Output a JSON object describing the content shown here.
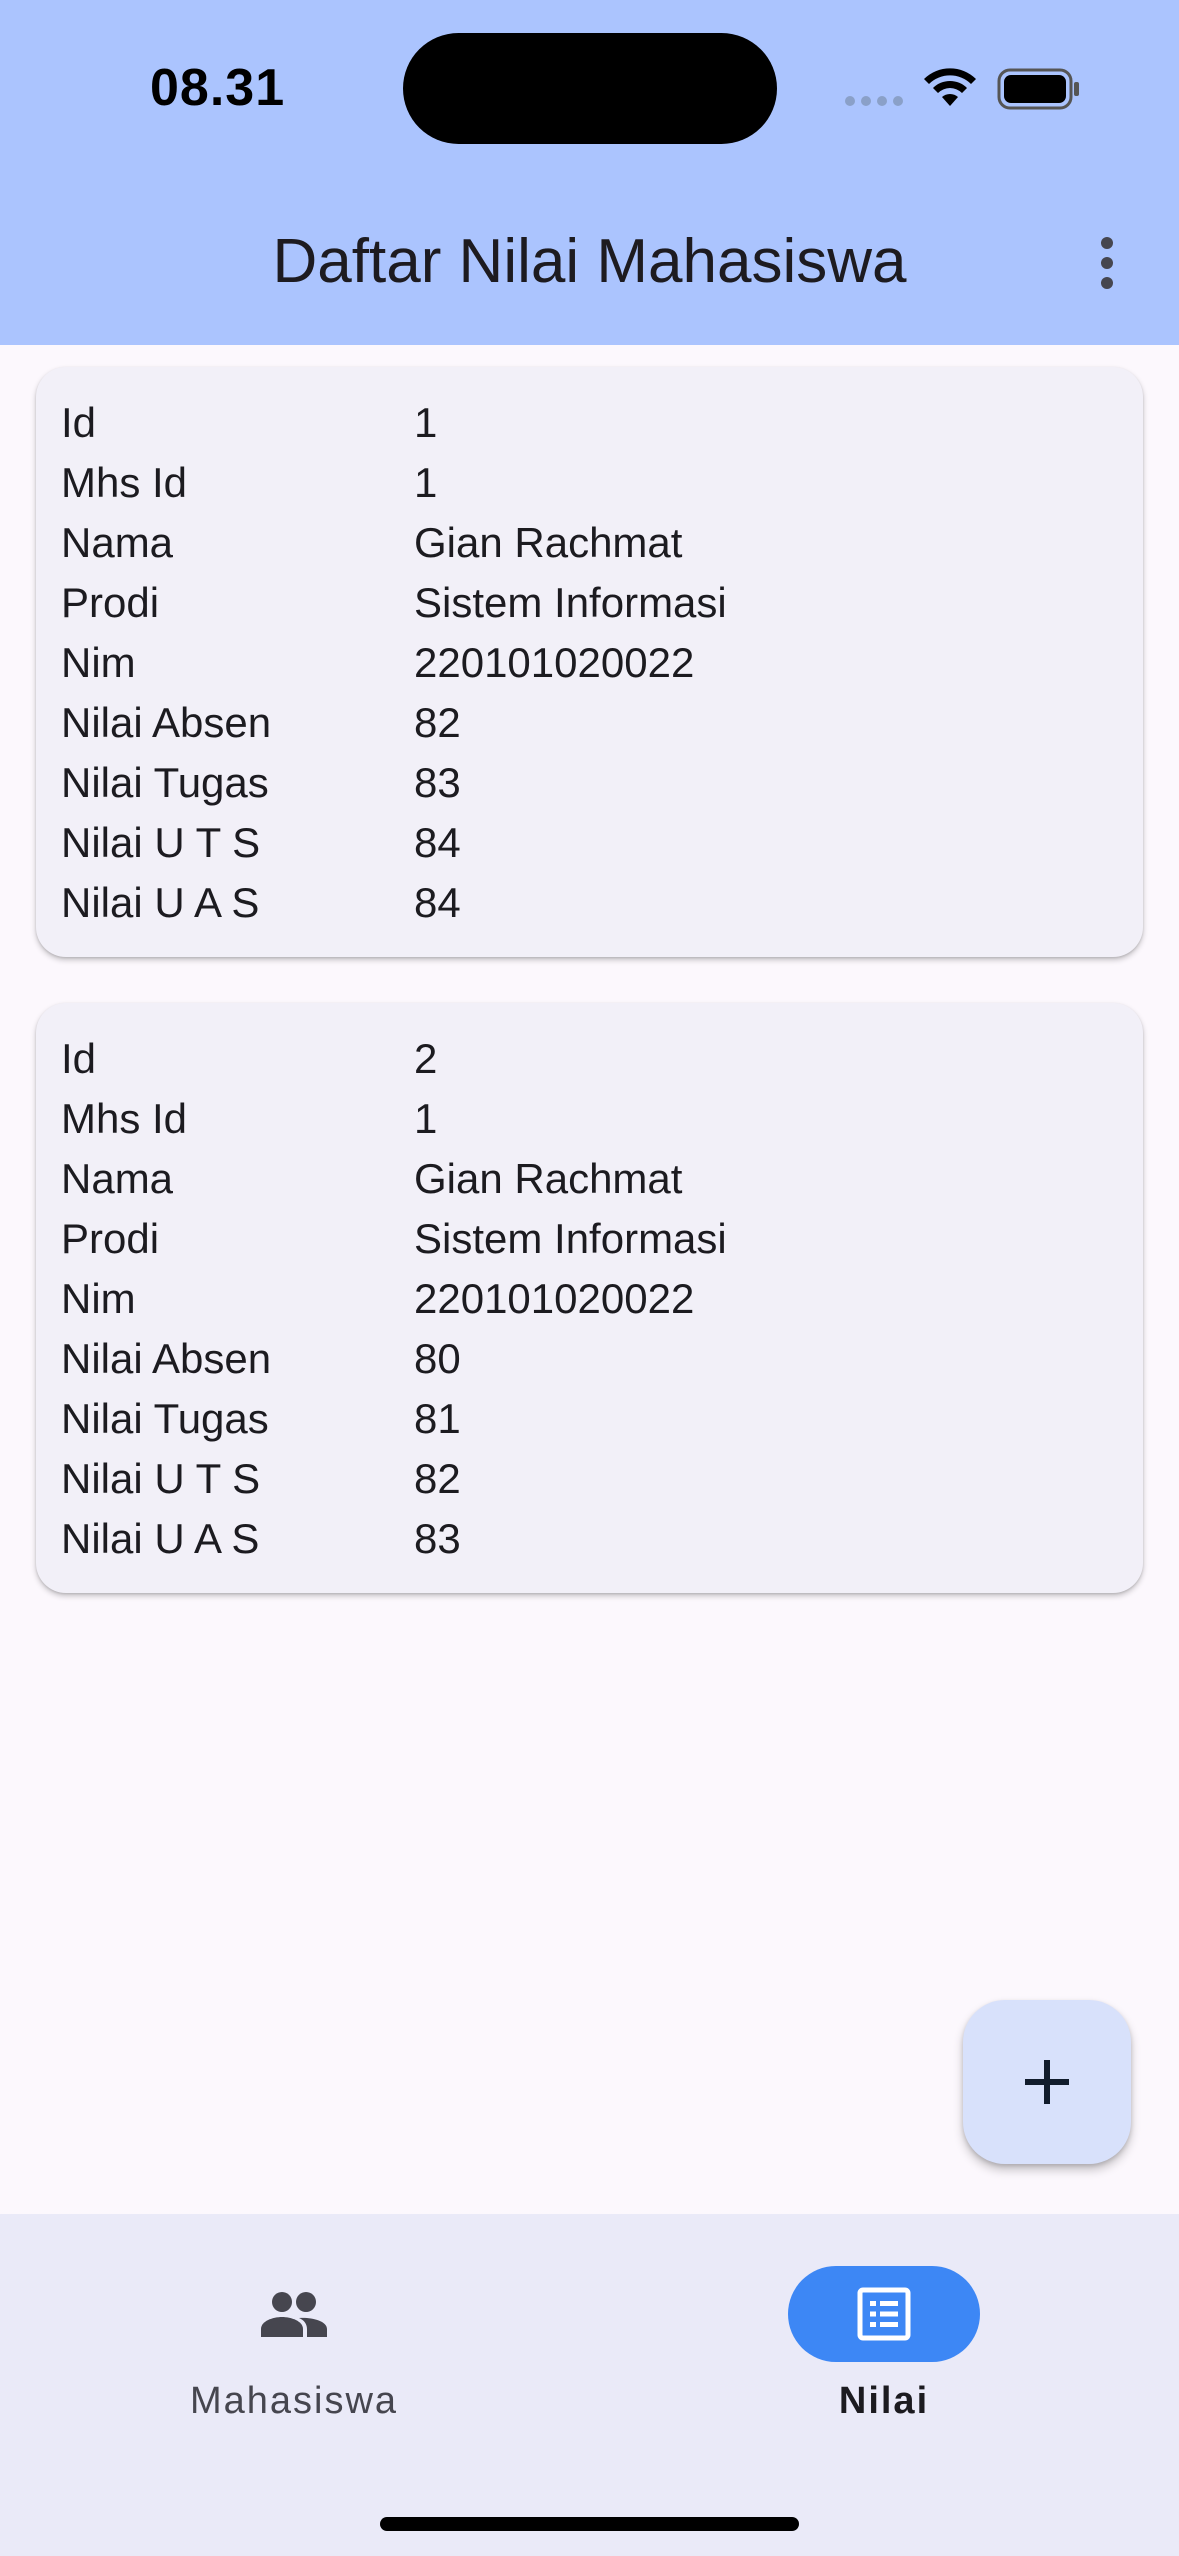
{
  "status_bar": {
    "time": "08.31"
  },
  "app_bar": {
    "title": "Daftar Nilai Mahasiswa"
  },
  "field_labels": {
    "id": "Id",
    "mhs_id": "Mhs Id",
    "nama": "Nama",
    "prodi": "Prodi",
    "nim": "Nim",
    "nilai_absen": "Nilai Absen",
    "nilai_tugas": "Nilai Tugas",
    "nilai_uts": "Nilai U T S",
    "nilai_uas": "Nilai U A S"
  },
  "records": [
    {
      "id": "1",
      "mhs_id": "1",
      "nama": "Gian Rachmat",
      "prodi": "Sistem Informasi",
      "nim": "220101020022",
      "nilai_absen": "82",
      "nilai_tugas": "83",
      "nilai_uts": "84",
      "nilai_uas": "84"
    },
    {
      "id": "2",
      "mhs_id": "1",
      "nama": "Gian Rachmat",
      "prodi": "Sistem Informasi",
      "nim": "220101020022",
      "nilai_absen": "80",
      "nilai_tugas": "81",
      "nilai_uts": "82",
      "nilai_uas": "83"
    }
  ],
  "fab": {
    "icon": "plus-icon"
  },
  "bottom_nav": {
    "items": [
      {
        "label": "Mahasiswa",
        "icon": "people-icon",
        "selected": false
      },
      {
        "label": "Nilai",
        "icon": "list-alt-icon",
        "selected": true
      }
    ]
  },
  "colors": {
    "app_bar": "#abc4fe",
    "nav_active": "#3d87f5",
    "fab": "#d8e1fb",
    "card": "#f2f0f8",
    "nav_bar": "#eaeaf8"
  }
}
